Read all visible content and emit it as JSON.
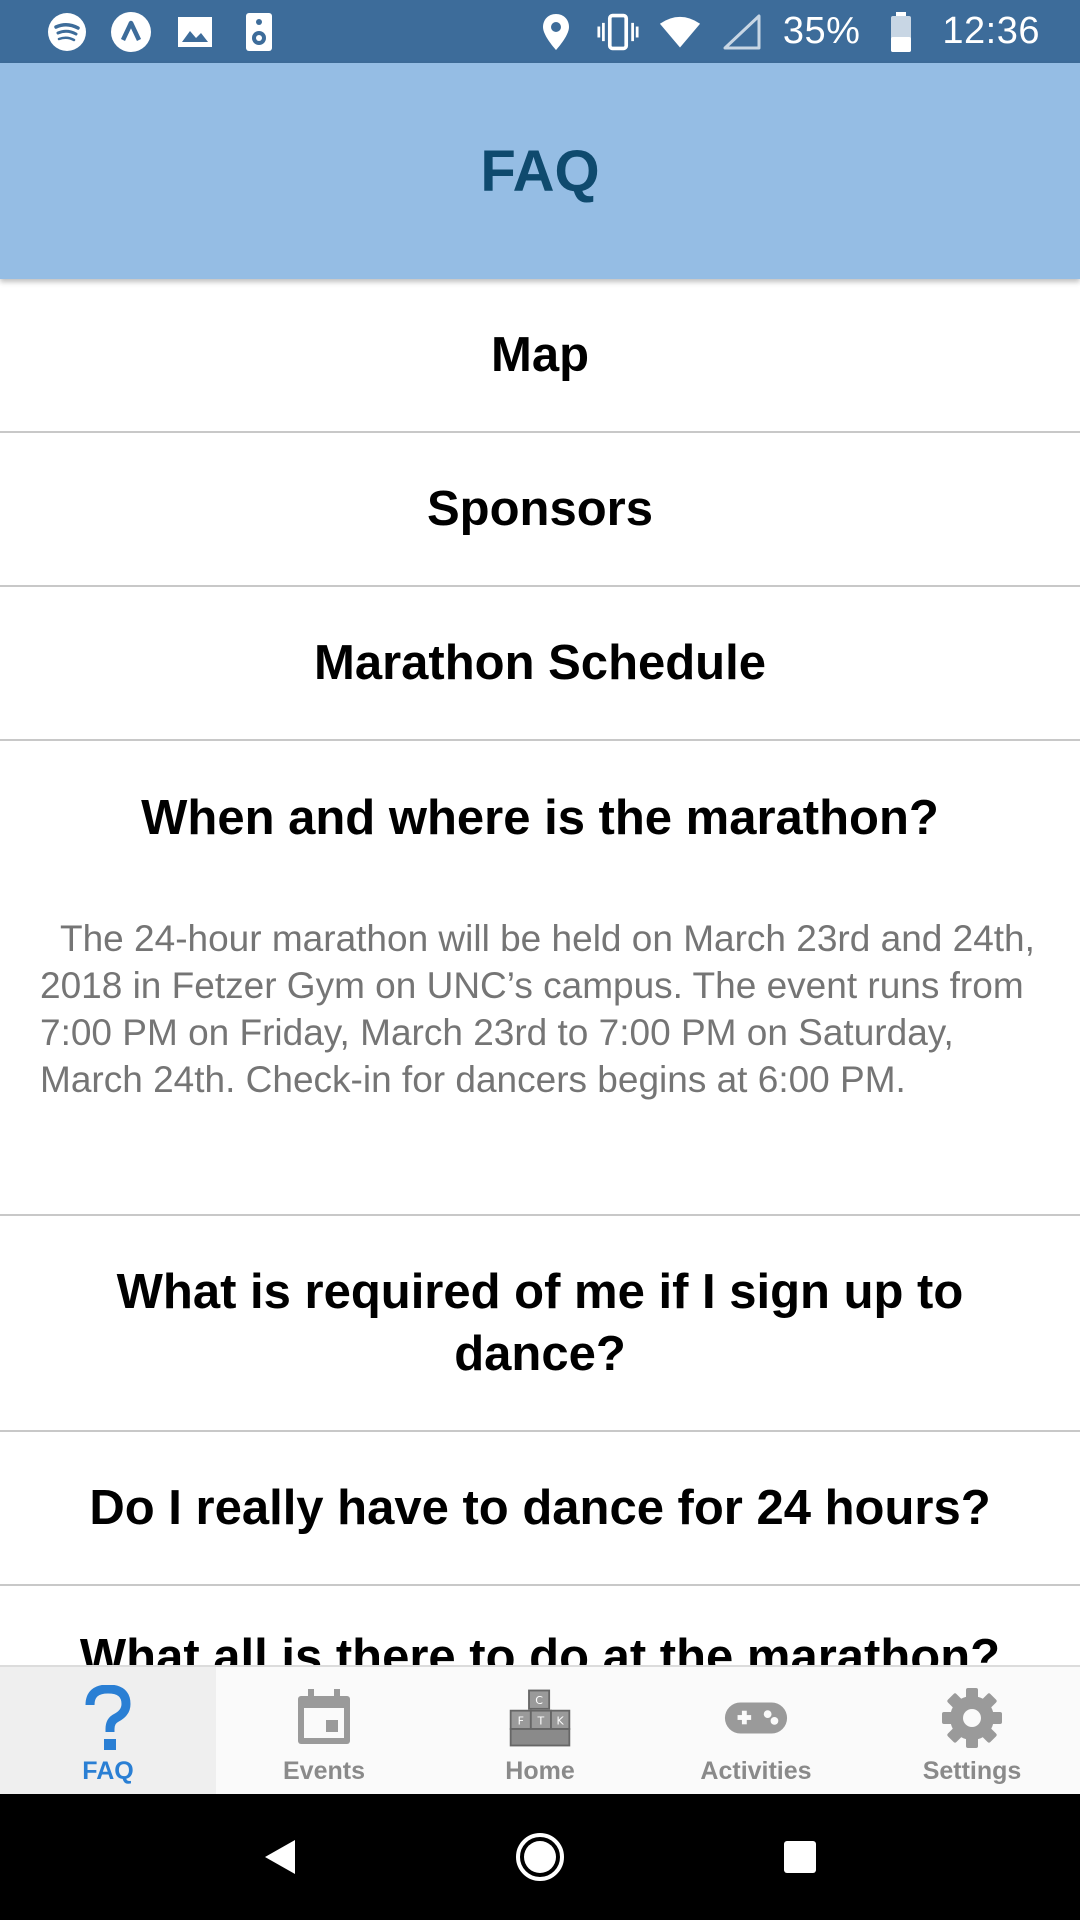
{
  "status_bar": {
    "battery": "35%",
    "time": "12:36",
    "left_icons": [
      "spotify-icon",
      "app-lambda-icon",
      "image-icon",
      "speaker-icon"
    ],
    "right_icons": [
      "location-icon",
      "vibrate-icon",
      "wifi-icon",
      "signal-icon",
      "battery-icon"
    ]
  },
  "header": {
    "title": "FAQ"
  },
  "faq": {
    "items": [
      {
        "question": "Map"
      },
      {
        "question": "Sponsors"
      },
      {
        "question": "Marathon Schedule"
      },
      {
        "question": "When and where is the marathon?",
        "answer": "The 24-hour marathon will be held on March 23rd and 24th, 2018 in Fetzer Gym on UNC’s campus. The event runs from 7:00 PM on Friday, March 23rd to 7:00 PM on Saturday, March 24th. Check-in for dancers begins at 6:00 PM."
      },
      {
        "question": "What is required of me if I sign up to dance?"
      },
      {
        "question": "Do I really have to dance for 24 hours?"
      },
      {
        "question": "What all is there to do at the marathon?"
      }
    ]
  },
  "tabs": [
    {
      "label": "FAQ",
      "icon": "question-icon",
      "active": true
    },
    {
      "label": "Events",
      "icon": "calendar-icon"
    },
    {
      "label": "Home",
      "icon": "blocks-icon"
    },
    {
      "label": "Activities",
      "icon": "gamepad-icon"
    },
    {
      "label": "Settings",
      "icon": "gear-icon"
    }
  ],
  "colors": {
    "status_bar": "#3d6c9a",
    "header_bg": "#95bde4",
    "header_title": "#0f4a6e",
    "active_tab": "#2a7fd4",
    "inactive_tab": "#8a8a8a"
  }
}
